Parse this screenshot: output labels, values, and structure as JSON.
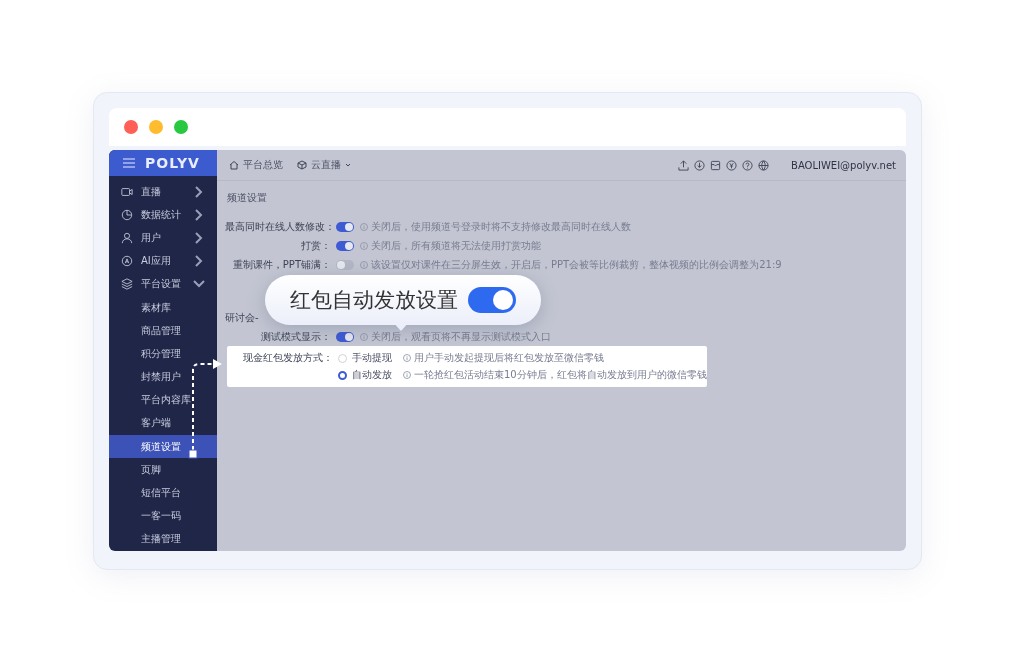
{
  "window": {
    "controls": [
      {
        "color": "#fe5f57"
      },
      {
        "color": "#febc2e"
      },
      {
        "color": "#28c840"
      }
    ]
  },
  "sidebar": {
    "logo": "POLYV",
    "items": [
      {
        "label": "直播",
        "expanded": false,
        "selected": false
      },
      {
        "label": "数据统计",
        "expanded": false,
        "selected": false
      },
      {
        "label": "用户",
        "expanded": false,
        "selected": false
      },
      {
        "label": "AI应用",
        "expanded": false,
        "selected": false
      },
      {
        "label": "平台设置",
        "expanded": true,
        "selected": false,
        "children": [
          {
            "label": "素材库",
            "selected": false
          },
          {
            "label": "商品管理",
            "selected": false
          },
          {
            "label": "积分管理",
            "selected": false
          },
          {
            "label": "封禁用户",
            "selected": false
          },
          {
            "label": "平台内容库",
            "selected": false
          },
          {
            "label": "客户端",
            "selected": false
          },
          {
            "label": "频道设置",
            "selected": true
          },
          {
            "label": "页脚",
            "selected": false
          },
          {
            "label": "短信平台",
            "selected": false
          },
          {
            "label": "一客一码",
            "selected": false
          },
          {
            "label": "主播管理",
            "selected": false
          }
        ]
      }
    ]
  },
  "topbar": {
    "nav": [
      {
        "label": "平台总览"
      },
      {
        "label": "云直播",
        "dropdown": true
      }
    ],
    "user": "BAOLIWEI@polyv.net"
  },
  "content": {
    "title": "频道设置",
    "rows": [
      {
        "kind": "toggle",
        "highlighted": false,
        "label": "最高同时在线人数修改：",
        "on": true,
        "hint": "关闭后，使用频道号登录时将不支持修改最高同时在线人数"
      },
      {
        "kind": "toggle",
        "highlighted": false,
        "label": "打赏：",
        "on": true,
        "hint": "关闭后，所有频道将无法使用打赏功能"
      },
      {
        "kind": "toggle",
        "highlighted": false,
        "label": "重制课件，PPT铺满：",
        "on": false,
        "hint": "该设置仅对课件在三分屏生效，开启后，PPT会被等比例裁剪，整体视频的比例会调整为21:9"
      },
      {
        "kind": "section",
        "highlighted": false,
        "label": "研讨会-"
      },
      {
        "kind": "toggle",
        "highlighted": false,
        "label": "测试模式显示：",
        "on": true,
        "hint": "关闭后，观看页将不再显示测试模式入口"
      },
      {
        "kind": "radio",
        "highlighted": true,
        "label": "现金红包发放方式：",
        "options": [
          {
            "label": "手动提现",
            "selected": false,
            "hint": "用户手动发起提现后将红包发放至微信零钱"
          },
          {
            "label": "自动发放",
            "selected": true,
            "hint": "一轮抢红包活动结束10分钟后，红包将自动发放到用户的微信零钱"
          }
        ]
      }
    ]
  },
  "callout": {
    "label": "红包自动发放设置",
    "on": true
  }
}
